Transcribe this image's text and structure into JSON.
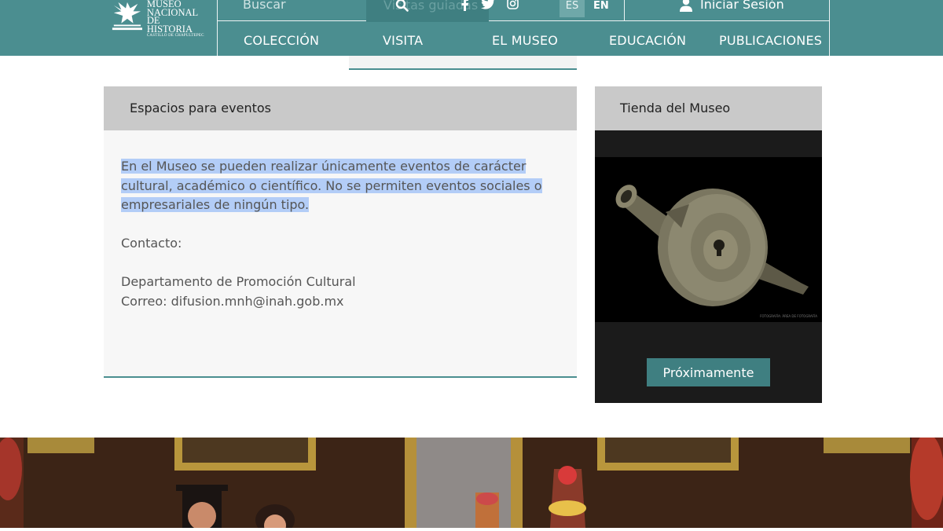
{
  "header": {
    "logo_line1": "MUSEO",
    "logo_line2": "NACIONAL",
    "logo_line3": "DE HISTORIA",
    "logo_sub": "CASTILLO DE CHAPULTEPEC",
    "search_placeholder": "Buscar",
    "ghost_button": "Visitas guiadas",
    "lang_es": "ES",
    "lang_en": "EN",
    "login": "Iniciar Sesión",
    "nav": [
      "COLECCIÓN",
      "VISITA",
      "EL MUSEO",
      "EDUCACIÓN",
      "PUBLICACIONES"
    ],
    "icons": [
      "search-icon",
      "facebook-icon",
      "twitter-icon",
      "instagram-icon",
      "user-icon"
    ]
  },
  "events_panel": {
    "title": "Espacios para eventos",
    "paragraph": "En el Museo se pueden realizar únicamente eventos de carácter cultural, académico o científico. No se permiten eventos sociales o empresariales de ningún tipo.",
    "contact_label": "Contacto:",
    "department": "Departamento de Promoción Cultural",
    "email": "Correo: difusion.mnh@inah.gob.mx"
  },
  "store_panel": {
    "title": "Tienda del Museo",
    "image_credit": "FOTOGRAFÍA: ÁREA DE FOTOGRAFÍA",
    "button": "Próximamente"
  },
  "colors": {
    "header_bg": "#4b8e90",
    "button_bg": "#3f7f81",
    "selection": "#b3cdf7",
    "panel_header": "#c9c9c9"
  }
}
